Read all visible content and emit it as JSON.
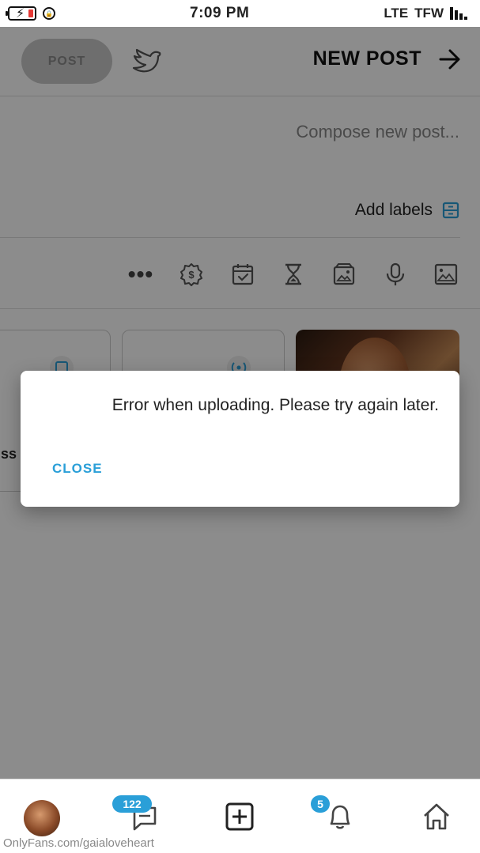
{
  "status_bar": {
    "time": "7:09 PM",
    "carrier": "TFW",
    "network": "LTE"
  },
  "header": {
    "title": "NEW POST",
    "post_label": "POST"
  },
  "compose": {
    "placeholder": "Compose new post..."
  },
  "labels": {
    "add_label": "Add labels"
  },
  "toolbar": {
    "icons": [
      "image-icon",
      "microphone-icon",
      "vault-icon",
      "hourglass-icon",
      "calendar-icon",
      "price-tag-icon",
      "more-icon"
    ],
    "more": "•••"
  },
  "cards": {
    "partial_label": "ss"
  },
  "dialog": {
    "message": "Error when uploading. Please try again later.",
    "close_label": "CLOSE"
  },
  "bottom_nav": {
    "messages_badge": "122",
    "notifications_badge": "5",
    "watermark": "OnlyFans.com/gaialoveheart"
  },
  "colors": {
    "accent": "#2a9fd8",
    "overlay": "rgba(0,0,0,0.45)"
  }
}
